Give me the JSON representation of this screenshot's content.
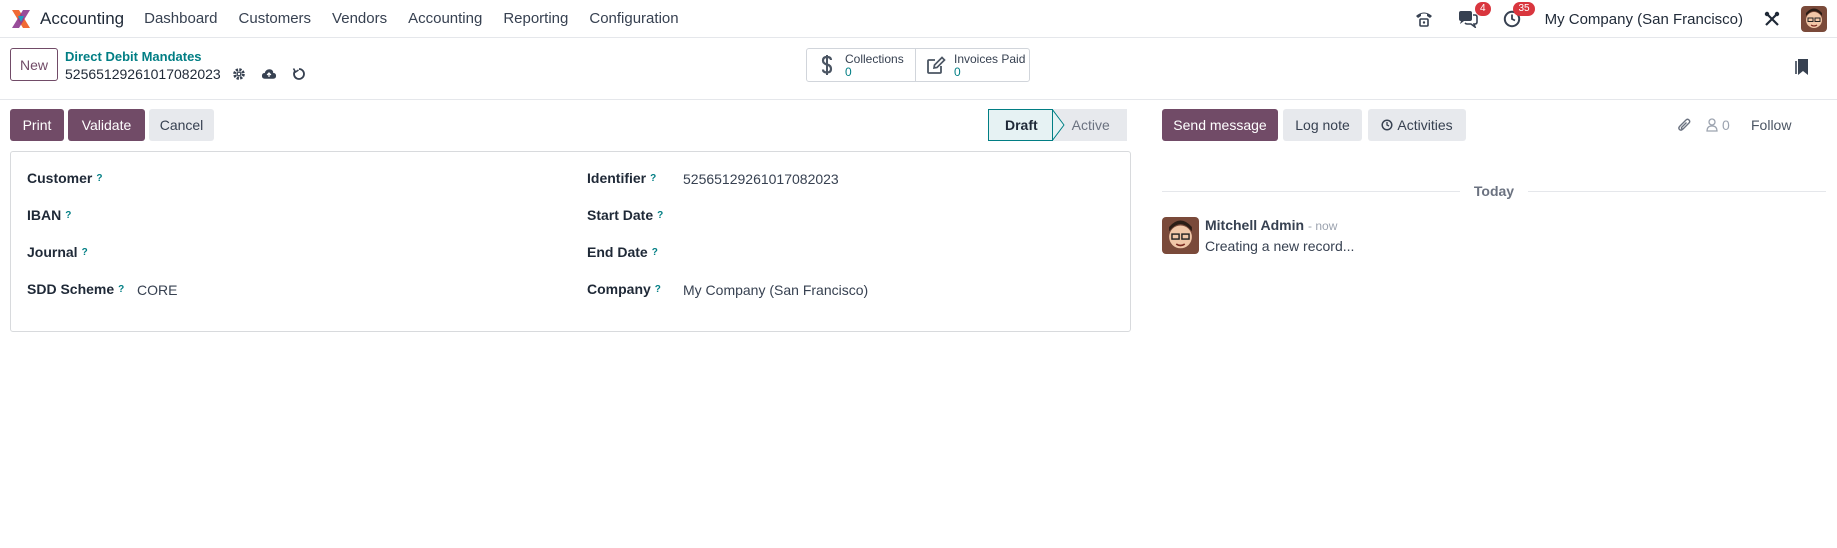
{
  "navbar": {
    "app_name": "Accounting",
    "menu": [
      "Dashboard",
      "Customers",
      "Vendors",
      "Accounting",
      "Reporting",
      "Configuration"
    ],
    "messages_badge": "4",
    "activities_badge": "35",
    "company": "My Company (San Francisco)"
  },
  "control_panel": {
    "new_label": "New",
    "breadcrumb": "Direct Debit Mandates",
    "record_name": "52565129261017082023",
    "smart_buttons": [
      {
        "label": "Collections",
        "value": "0",
        "icon": "dollar-icon"
      },
      {
        "label": "Invoices Paid",
        "value": "0",
        "icon": "pencil-square-icon"
      }
    ]
  },
  "statusbar": {
    "buttons": [
      "Print",
      "Validate",
      "Cancel"
    ],
    "stages": [
      "Draft",
      "Active"
    ],
    "current_stage": "Draft"
  },
  "form": {
    "left": [
      {
        "label": "Customer",
        "value": ""
      },
      {
        "label": "IBAN",
        "value": ""
      },
      {
        "label": "Journal",
        "value": ""
      },
      {
        "label": "SDD Scheme",
        "value": "CORE"
      }
    ],
    "right": [
      {
        "label": "Identifier",
        "value": "52565129261017082023"
      },
      {
        "label": "Start Date",
        "value": ""
      },
      {
        "label": "End Date",
        "value": ""
      },
      {
        "label": "Company",
        "value": "My Company (San Francisco)"
      }
    ]
  },
  "chatter": {
    "send_message": "Send message",
    "log_note": "Log note",
    "activities": "Activities",
    "followers_count": "0",
    "follow": "Follow",
    "date_separator": "Today",
    "messages": [
      {
        "author": "Mitchell Admin",
        "time": "- now",
        "body": "Creating a new record..."
      }
    ]
  },
  "colors": {
    "brand": "#714b67",
    "link": "#017e84",
    "badge": "#d9363e"
  }
}
